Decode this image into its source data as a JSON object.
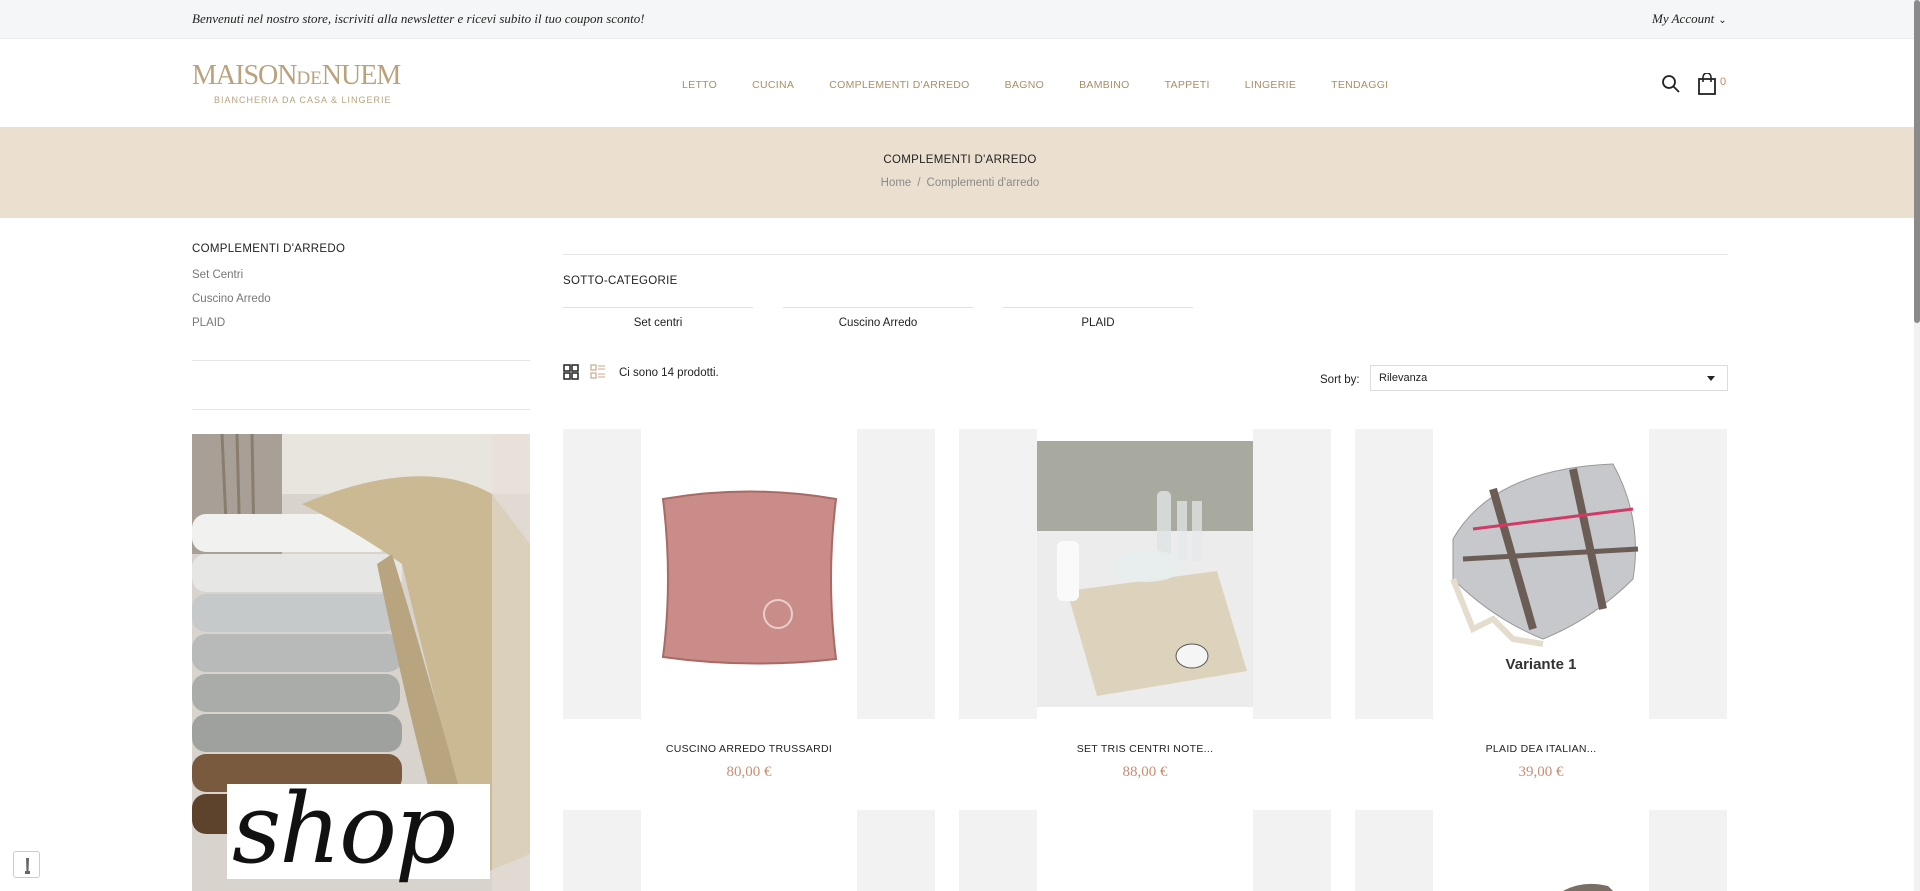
{
  "topbar": {
    "welcome": "Benvenuti nel nostro store, iscriviti alla newsletter e ricevi subito il tuo coupon sconto!",
    "account_label": "My Account",
    "account_icon": "chevron-down-icon"
  },
  "header": {
    "logo_text_1": "MAISON",
    "logo_text_2": "DE",
    "logo_text_3": "NUEM",
    "logo_tagline": "BIANCHERIA DA CASA & LINGERIE",
    "nav": [
      "LETTO",
      "CUCINA",
      "COMPLEMENTI D'ARREDO",
      "BAGNO",
      "BAMBINO",
      "TAPPETI",
      "LINGERIE",
      "TENDAGGI"
    ],
    "search_icon": "search-icon",
    "cart_icon": "shopping-bag-icon",
    "cart_count": "0"
  },
  "banner": {
    "title": "COMPLEMENTI D'ARREDO",
    "breadcrumb_home": "Home",
    "breadcrumb_sep": "/",
    "breadcrumb_current": "Complementi d'arredo"
  },
  "sidebar": {
    "title": "COMPLEMENTI D'ARREDO",
    "links": [
      "Set Centri",
      "Cuscino Arredo",
      "PLAID"
    ],
    "promo_text": "shop"
  },
  "content": {
    "subcategories_title": "SOTTO-CATEGORIE",
    "subcategories": [
      "Set centri",
      "Cuscino Arredo",
      "PLAID"
    ],
    "product_count": "Ci sono 14 prodotti.",
    "sort_label": "Sort by:",
    "sort_value": "Rilevanza",
    "grid_icon": "grid-view-icon",
    "list_icon": "list-view-icon"
  },
  "products": [
    {
      "name": "CUSCINO ARREDO TRUSSARDI",
      "price": "80,00 €"
    },
    {
      "name": "SET TRIS CENTRI NOTE...",
      "price": "88,00 €"
    },
    {
      "name": "PLAID DEA ITALIAN...",
      "price": "39,00 €",
      "image_label": "Variante 1"
    }
  ],
  "colors": {
    "accent": "#a98e66",
    "banner_bg": "#ebe0d0",
    "price": "#c98d74"
  }
}
